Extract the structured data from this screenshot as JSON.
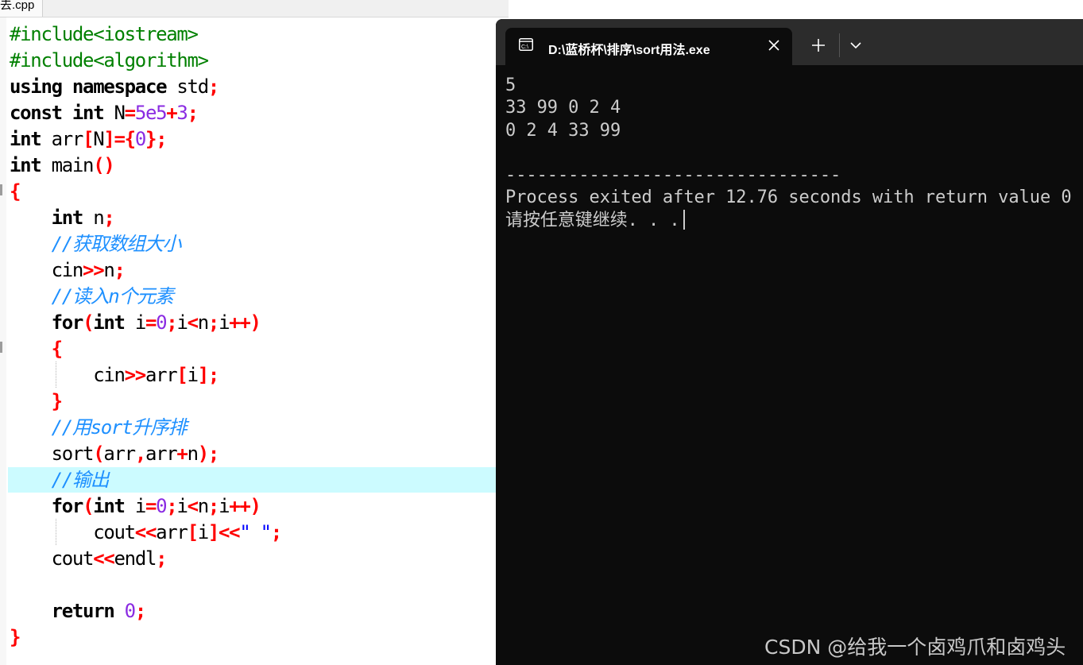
{
  "editor": {
    "tab_label": "去.cpp",
    "code_lines": [
      [
        {
          "t": "prep",
          "s": "#include<iostream>"
        }
      ],
      [
        {
          "t": "prep",
          "s": "#include<algorithm>"
        }
      ],
      [
        {
          "t": "kw",
          "s": "using namespace"
        },
        {
          "t": "id",
          "s": " std"
        },
        {
          "t": "op",
          "s": ";"
        }
      ],
      [
        {
          "t": "kw",
          "s": "const int"
        },
        {
          "t": "id",
          "s": " N"
        },
        {
          "t": "op",
          "s": "="
        },
        {
          "t": "num",
          "s": "5e5"
        },
        {
          "t": "op",
          "s": "+"
        },
        {
          "t": "num",
          "s": "3"
        },
        {
          "t": "op",
          "s": ";"
        }
      ],
      [
        {
          "t": "kw",
          "s": "int"
        },
        {
          "t": "id",
          "s": " arr"
        },
        {
          "t": "op",
          "s": "["
        },
        {
          "t": "id",
          "s": "N"
        },
        {
          "t": "op",
          "s": "]={"
        },
        {
          "t": "num",
          "s": "0"
        },
        {
          "t": "op",
          "s": "};"
        }
      ],
      [
        {
          "t": "kw",
          "s": "int"
        },
        {
          "t": "id",
          "s": " main"
        },
        {
          "t": "op",
          "s": "()"
        }
      ],
      [
        {
          "t": "op",
          "s": "{"
        }
      ],
      [
        {
          "t": "id",
          "s": "    "
        },
        {
          "t": "kw",
          "s": "int"
        },
        {
          "t": "id",
          "s": " n"
        },
        {
          "t": "op",
          "s": ";"
        }
      ],
      [
        {
          "t": "id",
          "s": "    "
        },
        {
          "t": "cmt",
          "s": "//获取数组大小"
        }
      ],
      [
        {
          "t": "id",
          "s": "    cin"
        },
        {
          "t": "op",
          "s": ">>"
        },
        {
          "t": "id",
          "s": "n"
        },
        {
          "t": "op",
          "s": ";"
        }
      ],
      [
        {
          "t": "id",
          "s": "    "
        },
        {
          "t": "cmt",
          "s": "//读入n个元素"
        }
      ],
      [
        {
          "t": "id",
          "s": "    "
        },
        {
          "t": "kw",
          "s": "for"
        },
        {
          "t": "op",
          "s": "("
        },
        {
          "t": "kw",
          "s": "int"
        },
        {
          "t": "id",
          "s": " i"
        },
        {
          "t": "op",
          "s": "="
        },
        {
          "t": "num",
          "s": "0"
        },
        {
          "t": "op",
          "s": ";"
        },
        {
          "t": "id",
          "s": "i"
        },
        {
          "t": "op",
          "s": "<"
        },
        {
          "t": "id",
          "s": "n"
        },
        {
          "t": "op",
          "s": ";"
        },
        {
          "t": "id",
          "s": "i"
        },
        {
          "t": "op",
          "s": "++)"
        }
      ],
      [
        {
          "t": "id",
          "s": "    "
        },
        {
          "t": "op",
          "s": "{"
        }
      ],
      [
        {
          "t": "id",
          "s": "        cin"
        },
        {
          "t": "op",
          "s": ">>"
        },
        {
          "t": "id",
          "s": "arr"
        },
        {
          "t": "op",
          "s": "["
        },
        {
          "t": "id",
          "s": "i"
        },
        {
          "t": "op",
          "s": "];"
        }
      ],
      [
        {
          "t": "id",
          "s": "    "
        },
        {
          "t": "op",
          "s": "}"
        }
      ],
      [
        {
          "t": "id",
          "s": "    "
        },
        {
          "t": "cmt",
          "s": "//用sort升序排"
        }
      ],
      [
        {
          "t": "id",
          "s": "    sort"
        },
        {
          "t": "op",
          "s": "("
        },
        {
          "t": "id",
          "s": "arr"
        },
        {
          "t": "op",
          "s": ","
        },
        {
          "t": "id",
          "s": "arr"
        },
        {
          "t": "op",
          "s": "+"
        },
        {
          "t": "id",
          "s": "n"
        },
        {
          "t": "op",
          "s": ");"
        }
      ],
      [
        {
          "t": "id",
          "s": "    "
        },
        {
          "t": "cmt",
          "s": "//输出"
        }
      ],
      [
        {
          "t": "id",
          "s": "    "
        },
        {
          "t": "kw",
          "s": "for"
        },
        {
          "t": "op",
          "s": "("
        },
        {
          "t": "kw",
          "s": "int"
        },
        {
          "t": "id",
          "s": " i"
        },
        {
          "t": "op",
          "s": "="
        },
        {
          "t": "num",
          "s": "0"
        },
        {
          "t": "op",
          "s": ";"
        },
        {
          "t": "id",
          "s": "i"
        },
        {
          "t": "op",
          "s": "<"
        },
        {
          "t": "id",
          "s": "n"
        },
        {
          "t": "op",
          "s": ";"
        },
        {
          "t": "id",
          "s": "i"
        },
        {
          "t": "op",
          "s": "++)"
        }
      ],
      [
        {
          "t": "id",
          "s": "        cout"
        },
        {
          "t": "op",
          "s": "<<"
        },
        {
          "t": "id",
          "s": "arr"
        },
        {
          "t": "op",
          "s": "["
        },
        {
          "t": "id",
          "s": "i"
        },
        {
          "t": "op",
          "s": "]<<"
        },
        {
          "t": "str",
          "s": "\" \""
        },
        {
          "t": "op",
          "s": ";"
        }
      ],
      [
        {
          "t": "id",
          "s": "    cout"
        },
        {
          "t": "op",
          "s": "<<"
        },
        {
          "t": "id",
          "s": "endl"
        },
        {
          "t": "op",
          "s": ";"
        }
      ],
      [
        {
          "t": "id",
          "s": ""
        }
      ],
      [
        {
          "t": "id",
          "s": "    "
        },
        {
          "t": "kw",
          "s": "return"
        },
        {
          "t": "id",
          "s": " "
        },
        {
          "t": "num",
          "s": "0"
        },
        {
          "t": "op",
          "s": ";"
        }
      ],
      [
        {
          "t": "op",
          "s": "}"
        }
      ]
    ],
    "highlight_color": "#ccfbff"
  },
  "terminal": {
    "tab_title": "D:\\蓝桥杯\\排序\\sort用法.exe",
    "app_icon": "console-icon",
    "output_lines": [
      "5",
      "33 99 0 2 4",
      "0 2 4 33 99",
      "",
      "--------------------------------",
      "Process exited after 12.76 seconds with return value 0",
      "请按任意键继续. . ."
    ]
  },
  "watermark": "CSDN @给我一个卤鸡爪和卤鸡头"
}
